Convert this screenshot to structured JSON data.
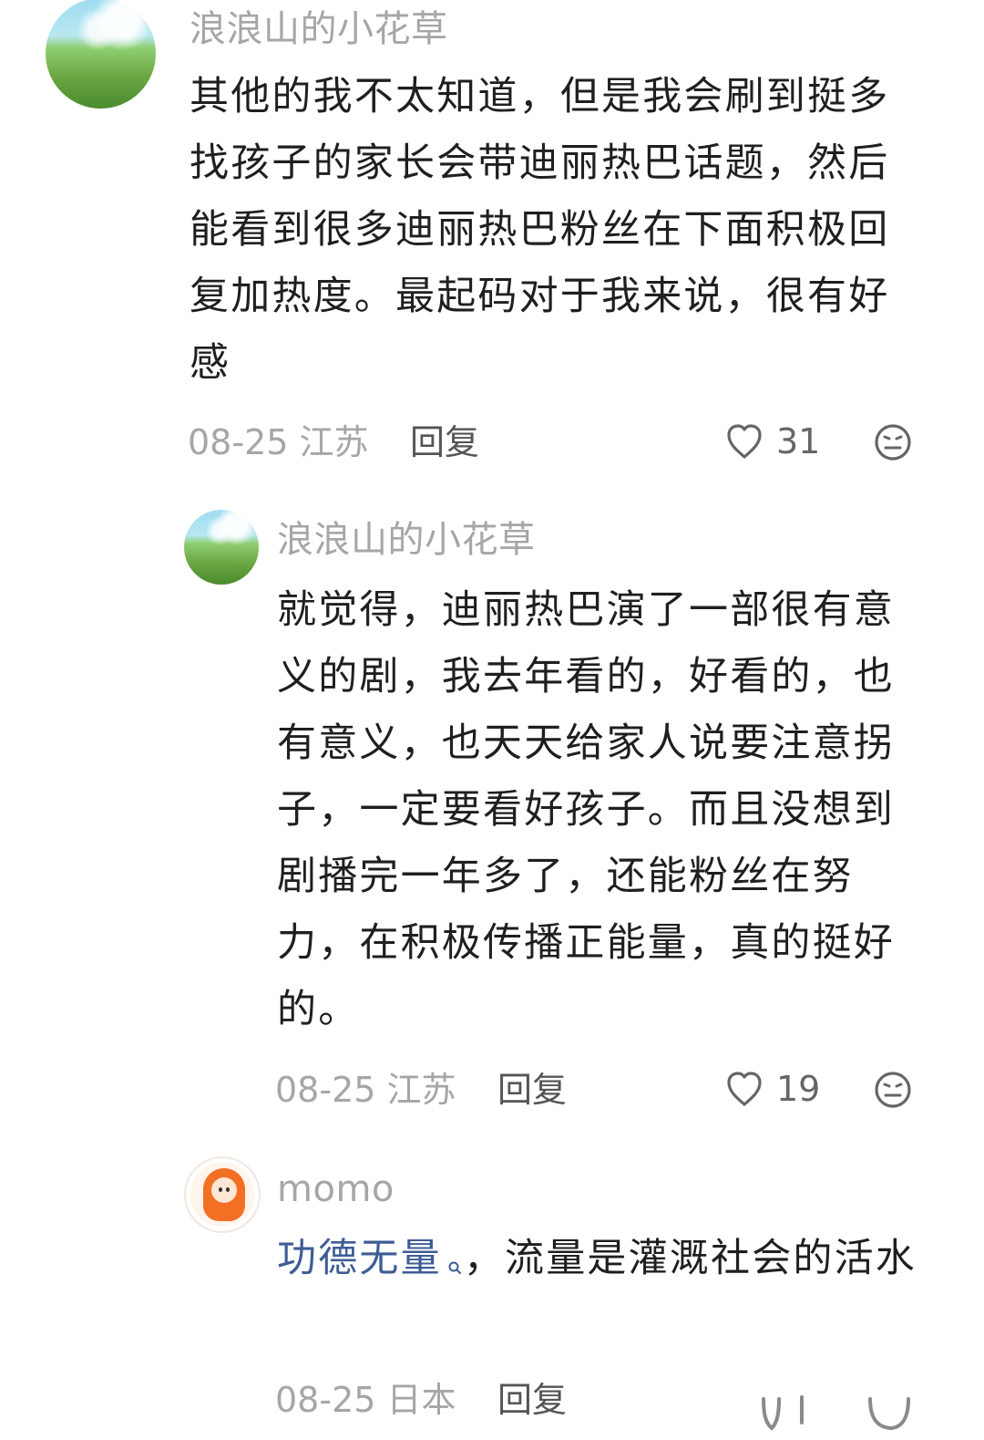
{
  "comments": [
    {
      "username": "浪浪山的小花草",
      "content": "其他的我不太知道，但是我会刷到挺多找孩子的家长会带迪丽热巴话题，然后能看到很多迪丽热巴粉丝在下面积极回复加热度。最起码对于我来说，很有好感",
      "date_location": "08-25 江苏",
      "reply_label": "回复",
      "likes": "31"
    },
    {
      "username": "浪浪山的小花草",
      "content": "就觉得，迪丽热巴演了一部很有意义的剧，我去年看的，好看的，也有意义，也天天给家人说要注意拐子，一定要看好孩子。而且没想到剧播完一年多了，还能粉丝在努力，在积极传播正能量，真的挺好的。",
      "date_location": "08-25 江苏",
      "reply_label": "回复",
      "likes": "19"
    },
    {
      "username": "momo",
      "mention": "功德无量",
      "content": "，流量是灌溉社会的活水",
      "date_location": "08-25 日本",
      "reply_label": "回复"
    }
  ]
}
